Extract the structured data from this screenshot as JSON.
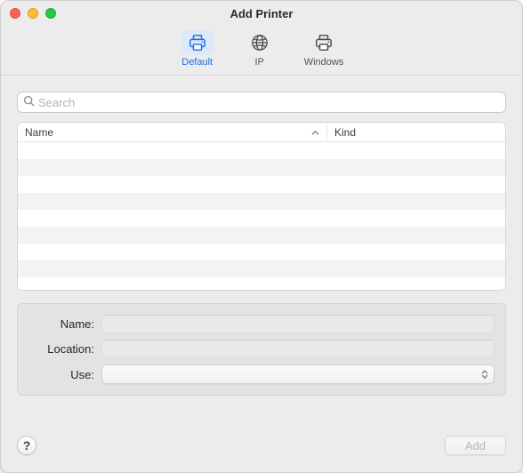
{
  "window": {
    "title": "Add Printer"
  },
  "toolbar": {
    "tabs": [
      {
        "id": "default",
        "label": "Default",
        "active": true
      },
      {
        "id": "ip",
        "label": "IP",
        "active": false
      },
      {
        "id": "windows",
        "label": "Windows",
        "active": false
      }
    ]
  },
  "search": {
    "placeholder": "Search",
    "value": ""
  },
  "table": {
    "columns": [
      {
        "id": "name",
        "label": "Name",
        "sorted": true
      },
      {
        "id": "kind",
        "label": "Kind",
        "sorted": false
      }
    ],
    "rows": []
  },
  "form": {
    "name": {
      "label": "Name:",
      "value": ""
    },
    "location": {
      "label": "Location:",
      "value": ""
    },
    "use": {
      "label": "Use:",
      "selected": ""
    }
  },
  "footer": {
    "help_label": "?",
    "add_label": "Add",
    "add_enabled": false
  }
}
